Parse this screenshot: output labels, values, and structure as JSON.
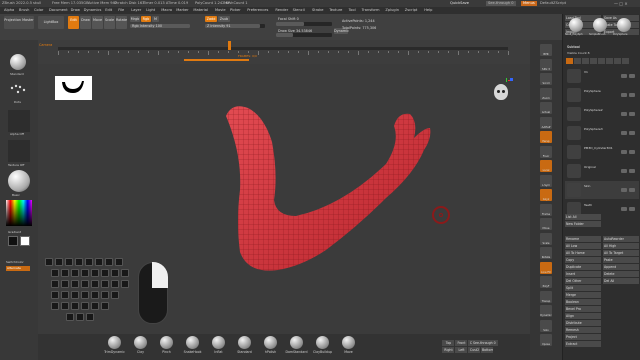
{
  "titlebar": {
    "app": "ZBrush 2022.0.5",
    "doc": "skull",
    "free_mem": "Free Mem 17.035GB",
    "active_mem": "Active Mem 947",
    "scratch_disk": "Scratch Disk 163",
    "timer": "Timer 0.013 ATime 0.019",
    "polycount": "PolyCount 1.242 KP",
    "meshcount": "MeshCount 1",
    "quicksave": "QuickSave",
    "seethrough": "See-through 0",
    "menus_btn": "Menus",
    "script": "DefaultZScript"
  },
  "menubar": [
    "Alpha",
    "Brush",
    "Color",
    "Document",
    "Draw",
    "Dynamics",
    "Edit",
    "File",
    "Layer",
    "Light",
    "Macro",
    "Marker",
    "Material",
    "Movie",
    "Picker",
    "Preferences",
    "Render",
    "Stencil",
    "Stroke",
    "Texture",
    "Tool",
    "Transform",
    "Zplugin",
    "Zscript",
    "Help"
  ],
  "toolbar": {
    "projection_master": "Projection Master",
    "lightbox": "LightBox",
    "edit": "Edit",
    "draw": "Draw",
    "move": "Move",
    "scale": "Scale",
    "rotate": "Rotate",
    "mrgb": "Mrgb",
    "rgb": "Rgb",
    "m": "M",
    "rgb_intensity": "Rgb Intensity 100",
    "zadd": "Zadd",
    "zsub": "Zsub",
    "z_intensity": "Z Intensity 91",
    "focal_shift": "Focal Shift 0",
    "draw_size": "Draw Size 34.53846",
    "active_points": "ActivePoints: 1,244",
    "total_points": "TotalPoints: 775,306",
    "dynamic": "Dynamic"
  },
  "ruler": {
    "label": "Camera",
    "frame_label": "FRAMES: 0/0"
  },
  "left_panel": {
    "brush_label": "Standard",
    "stroke_label": "Dots",
    "alpha_label": "Alpha Off",
    "texture_label": "Texture Off",
    "material_label": "Basic",
    "gradient_label": "Gradient",
    "switchcolor_label": "SwitchColor",
    "alternate_label": "Alternate"
  },
  "right_strip": {
    "labels": [
      "BPR",
      "SPix 3",
      "Scroll",
      "Zoom",
      "Actual",
      "AAHalf",
      "Persp",
      "Floor",
      "Local",
      "L.Sym",
      "Gxyz",
      "Frame",
      "Move",
      "Scale",
      "Rotate",
      "Line Fill",
      "PolyF",
      "Transp",
      "Dynamic",
      "Solo",
      "Xpose"
    ]
  },
  "right_panel": {
    "header_buttons": [
      "Load Tool",
      "Save As",
      "Copy Tool",
      "Paste Tool",
      "Import",
      "Export",
      "Clone",
      "Make PolyMesh3D",
      "GoZ",
      "All",
      "Visible",
      "R"
    ],
    "tool_thumbs": [
      "Skull_PolySph",
      "SimpleBrush",
      "PolySphere"
    ],
    "subtool_title": "Subtool",
    "visible_count": "Visible Count 8",
    "subtools": [
      {
        "name": "V1"
      },
      {
        "name": "PolySphere"
      },
      {
        "name": "PolySphere2"
      },
      {
        "name": "PolySphere3"
      },
      {
        "name": "PM3D_Cylinder3D1"
      },
      {
        "name": "Original"
      },
      {
        "name": "Skin"
      },
      {
        "name": "Teeth"
      }
    ],
    "list_all": "List All",
    "new_folder": "New Folder",
    "actions": [
      "Rename",
      "AutoReorder",
      "All Low",
      "All High",
      "All To Home",
      "All To Target",
      "Copy",
      "Paste",
      "Duplicate",
      "Append",
      "Insert",
      "Delete",
      "Del Other",
      "Del All",
      "Split",
      "Merge",
      "Boolean",
      "Bevel Pro",
      "Align",
      "Distribute",
      "Remesh",
      "Project",
      "Extract"
    ]
  },
  "bottom_bar": {
    "brushes": [
      "TrimDynamic",
      "Clay",
      "Pinch",
      "SnakeHook",
      "Inflat",
      "Standard",
      "hPolish",
      "DamStandard",
      "ClayBuildup",
      "Move"
    ],
    "nav": [
      "Top",
      "Front",
      "Cust1",
      "Back",
      "Right",
      "Left",
      "Cust2",
      "Bottom"
    ],
    "seethrough": "See-through 0"
  },
  "colors": {
    "accent": "#e07a10",
    "model": "#d9333b",
    "bg": "#3b3b3b"
  }
}
